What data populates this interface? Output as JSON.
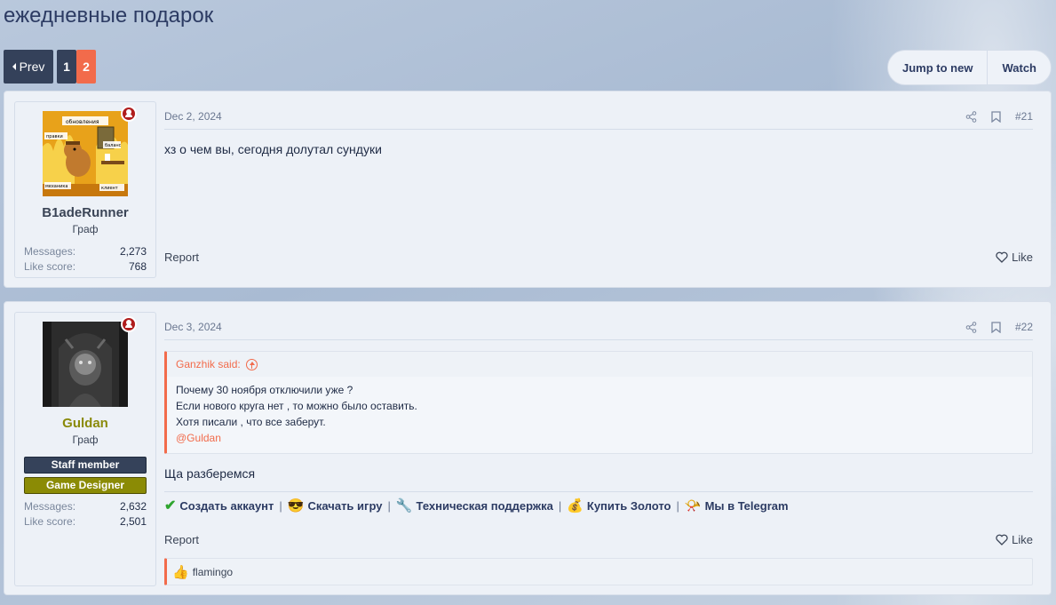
{
  "thread": {
    "title": "ежедневные подарок"
  },
  "pager": {
    "prev_label": "Prev",
    "pages": [
      "1",
      "2"
    ],
    "current": "2"
  },
  "actions": {
    "jump_label": "Jump to new",
    "watch_label": "Watch"
  },
  "posts": [
    {
      "user": {
        "name": "B1adeRunner",
        "title": "Граф",
        "messages_label": "Messages:",
        "messages": "2,273",
        "likes_label": "Like score:",
        "likes": "768",
        "avatar_texts": [
          "обновления",
          "правки",
          "баланс",
          "механика",
          "клиент"
        ]
      },
      "date": "Dec 2, 2024",
      "number": "#21",
      "body": "хз о чем вы, сегодня долутал сундуки",
      "report_label": "Report",
      "like_label": "Like"
    },
    {
      "user": {
        "name": "Guldan",
        "title": "Граф",
        "banners": [
          "Staff member",
          "Game Designer"
        ],
        "messages_label": "Messages:",
        "messages": "2,632",
        "likes_label": "Like score:",
        "likes": "2,501"
      },
      "date": "Dec 3, 2024",
      "number": "#22",
      "quote": {
        "author": "Ganzhik said:",
        "lines": [
          "Почему 30 ноября отключили уже ?",
          "Если нового круга нет , то можно было оставить.",
          "Хотя писали , что все заберут."
        ],
        "mention": "@Guldan"
      },
      "body": "Ща разберемся",
      "signature": {
        "links": [
          {
            "icon": "✔",
            "label": "Создать аккаунт"
          },
          {
            "icon": "😎",
            "label": "Скачать игру"
          },
          {
            "icon": "🔧",
            "label": "Техническая поддержка"
          },
          {
            "icon": "💰",
            "label": "Купить Золото"
          },
          {
            "icon": "📯",
            "label": "Мы в Telegram"
          }
        ],
        "separator": "|"
      },
      "report_label": "Report",
      "like_label": "Like",
      "reactions": {
        "icon": "👍",
        "users": "flamingo"
      }
    }
  ],
  "colors": {
    "accent": "#f26b4b",
    "dark": "#34415a",
    "gold": "#8a8a0a"
  }
}
